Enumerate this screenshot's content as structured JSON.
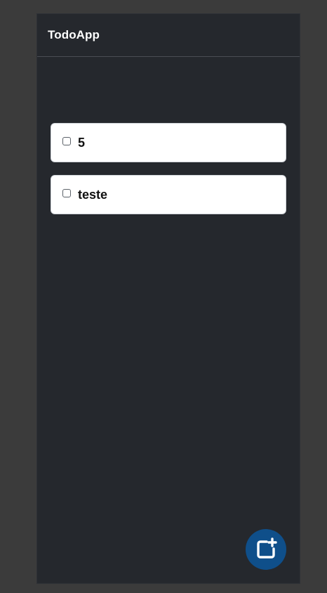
{
  "header": {
    "title": "TodoApp"
  },
  "todos": [
    {
      "text": "5",
      "checked": false
    },
    {
      "text": "teste",
      "checked": false
    }
  ],
  "fab": {
    "icon": "add-note-icon"
  },
  "colors": {
    "background": "#3b3b3b",
    "app_background": "#25282d",
    "card": "#ffffff",
    "fab": "#0f4f8a",
    "header_text": "#ffffff"
  }
}
